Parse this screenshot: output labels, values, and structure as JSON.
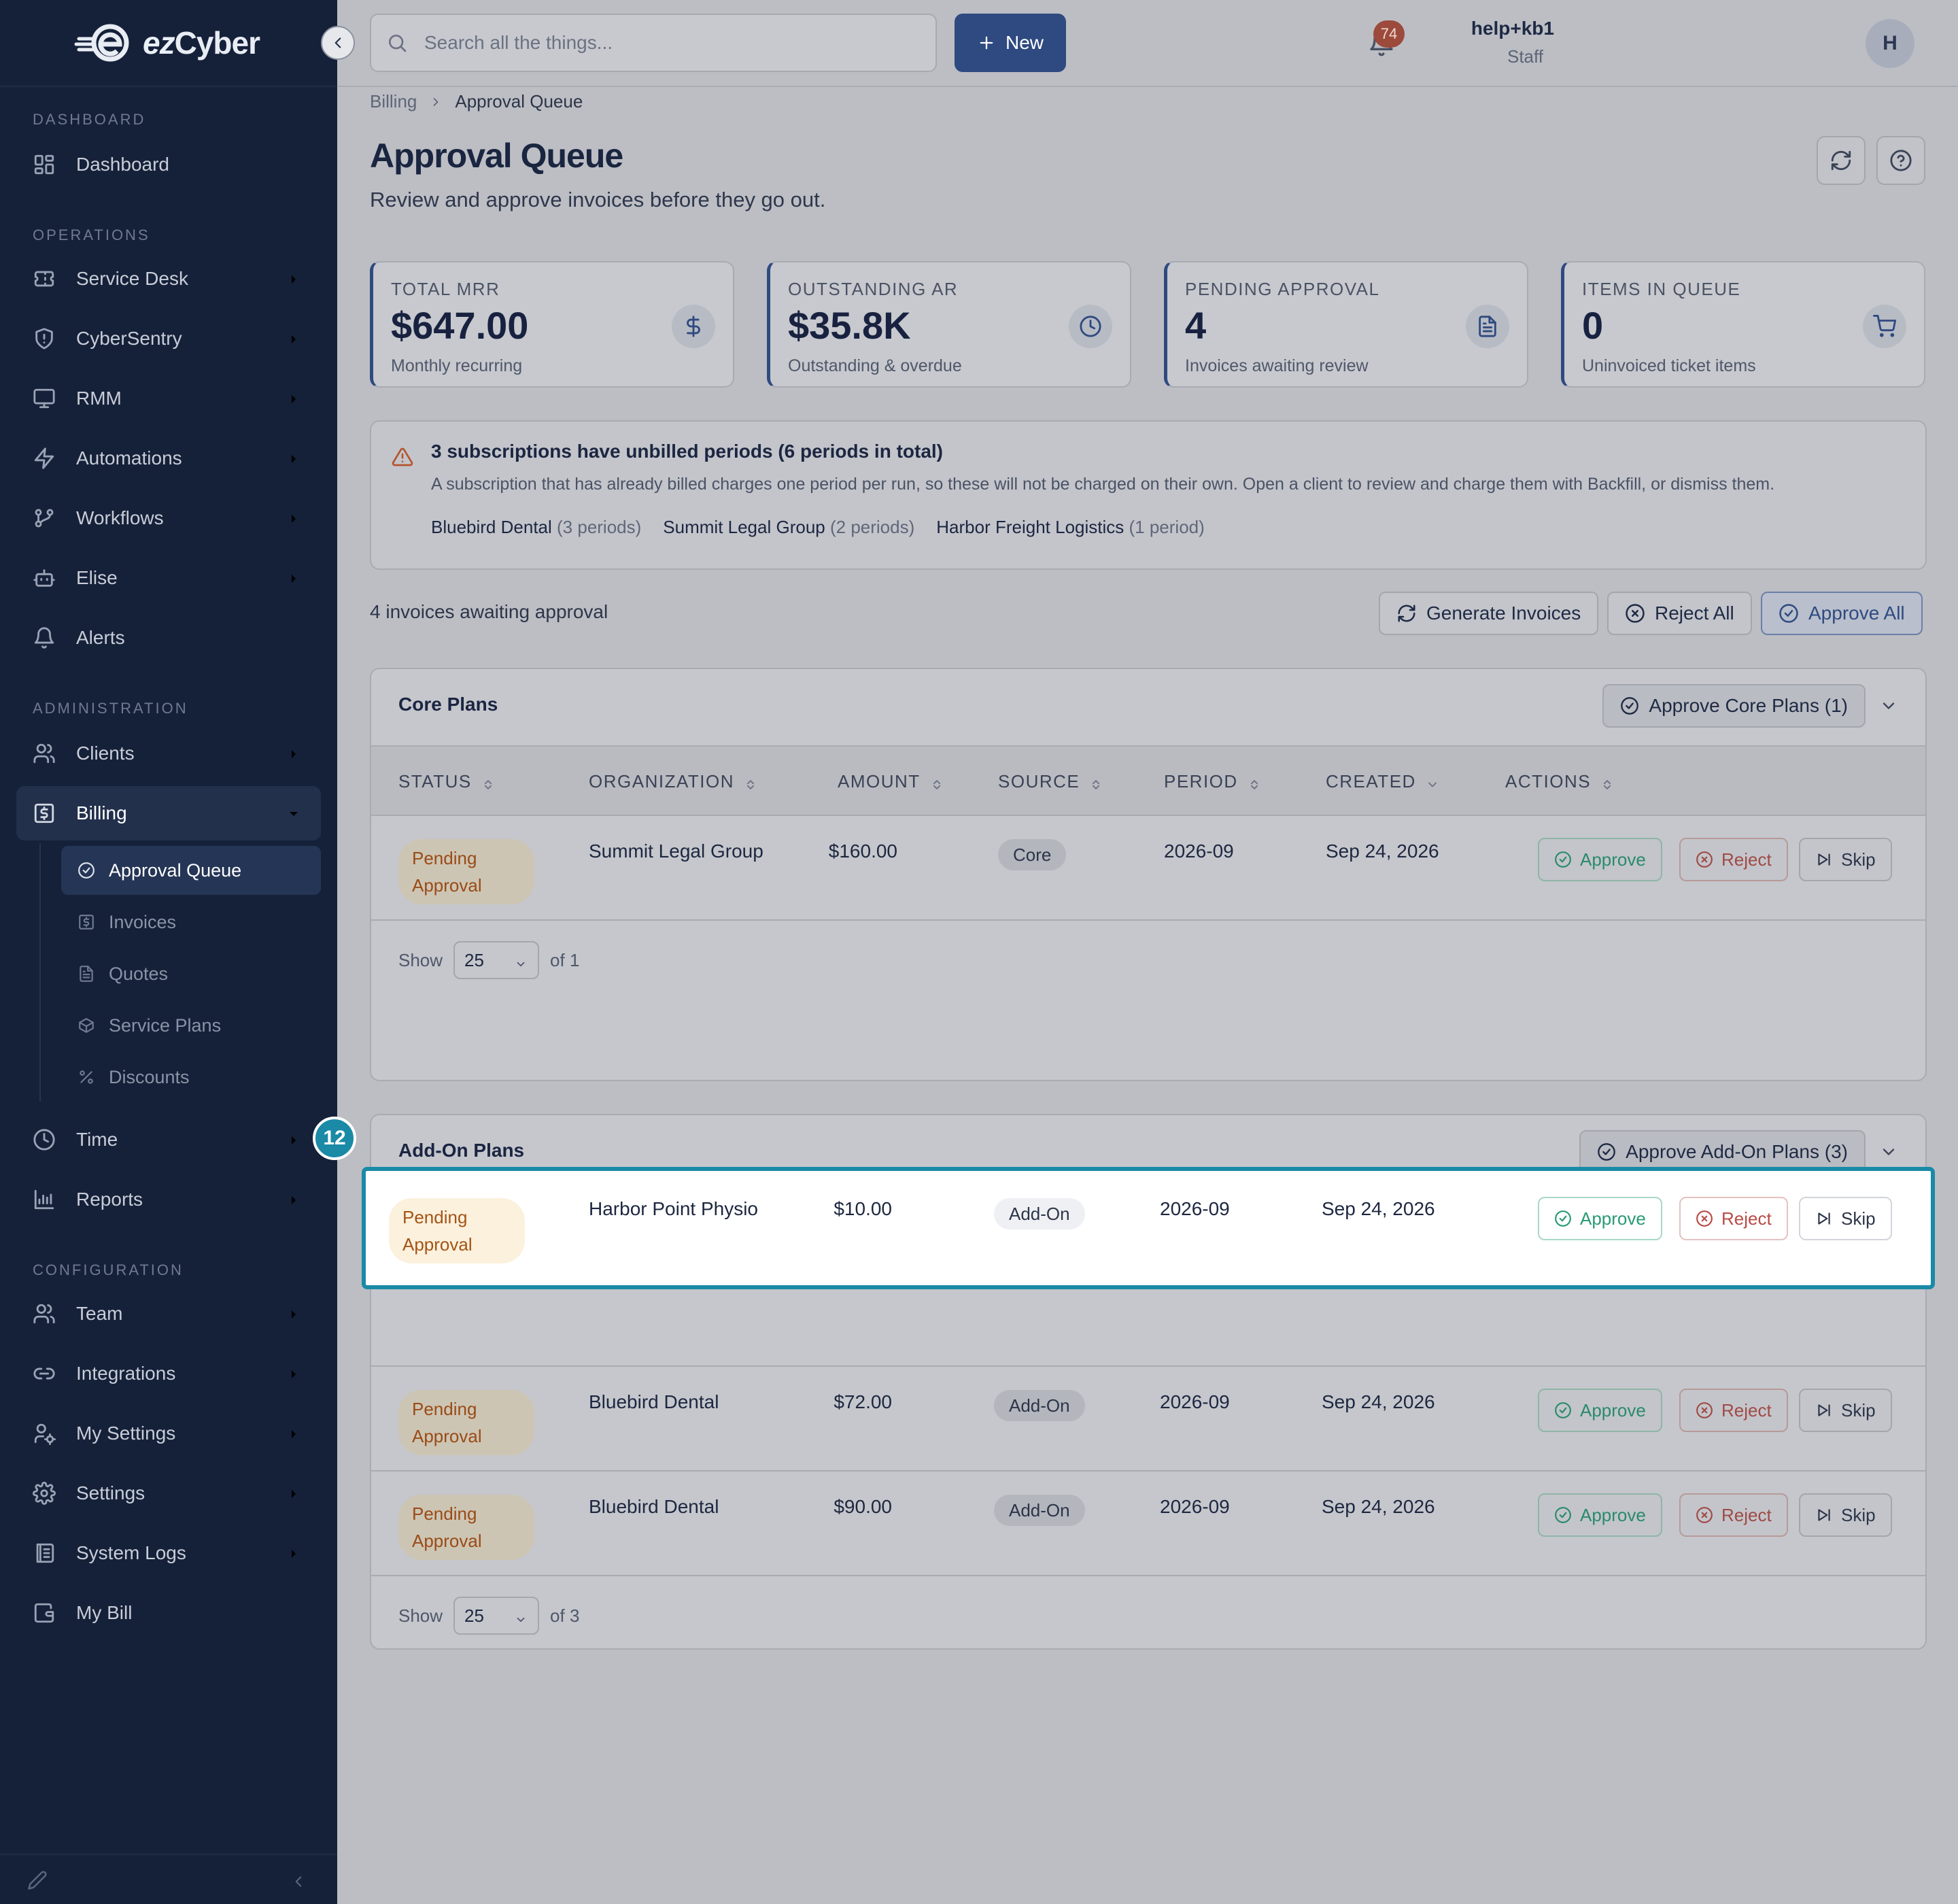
{
  "brand": {
    "name_prefix": "ez",
    "name_suffix": "Cyber"
  },
  "sidebar": {
    "sections": {
      "dashboard": "DASHBOARD",
      "operations": "OPERATIONS",
      "administration": "ADMINISTRATION",
      "configuration": "CONFIGURATION"
    },
    "items": {
      "dashboard": "Dashboard",
      "service_desk": "Service Desk",
      "cybersentry": "CyberSentry",
      "rmm": "RMM",
      "automations": "Automations",
      "workflows": "Workflows",
      "elise": "Elise",
      "alerts": "Alerts",
      "clients": "Clients",
      "billing": "Billing",
      "time": "Time",
      "reports": "Reports",
      "team": "Team",
      "integrations": "Integrations",
      "my_settings": "My Settings",
      "settings": "Settings",
      "system_logs": "System Logs",
      "my_bill": "My Bill"
    },
    "billing_sub": {
      "approval_queue": "Approval Queue",
      "invoices": "Invoices",
      "quotes": "Quotes",
      "service_plans": "Service Plans",
      "discounts": "Discounts"
    }
  },
  "header": {
    "search_placeholder": "Search all the things...",
    "new_label": "New",
    "notification_count": "74",
    "user_name": "help+kb1",
    "user_role": "Staff",
    "avatar_initial": "H"
  },
  "breadcrumb": {
    "parent": "Billing",
    "current": "Approval Queue"
  },
  "page": {
    "title": "Approval Queue",
    "subtitle": "Review and approve invoices before they go out."
  },
  "stats": [
    {
      "label": "TOTAL MRR",
      "value": "$647.00",
      "desc": "Monthly recurring",
      "icon": "dollar-icon"
    },
    {
      "label": "OUTSTANDING AR",
      "value": "$35.8K",
      "desc": "Outstanding & overdue",
      "icon": "clock-icon"
    },
    {
      "label": "PENDING APPROVAL",
      "value": "4",
      "desc": "Invoices awaiting review",
      "icon": "document-icon"
    },
    {
      "label": "ITEMS IN QUEUE",
      "value": "0",
      "desc": "Uninvoiced ticket items",
      "icon": "cart-icon"
    }
  ],
  "alert": {
    "title": "3 subscriptions have unbilled periods (6 periods in total)",
    "body": "A subscription that has already billed charges one period per run, so these will not be charged on their own. Open a client to review and charge them with Backfill, or dismiss them.",
    "chips": [
      {
        "name": "Bluebird Dental",
        "periods": "(3 periods)"
      },
      {
        "name": "Summit Legal Group",
        "periods": "(2 periods)"
      },
      {
        "name": "Harbor Freight Logistics",
        "periods": "(1 period)"
      }
    ]
  },
  "toolbar": {
    "count_text": "4 invoices awaiting approval",
    "generate": "Generate Invoices",
    "reject_all": "Reject All",
    "approve_all": "Approve All"
  },
  "columns": {
    "status": "STATUS",
    "organization": "ORGANIZATION",
    "amount": "AMOUNT",
    "source": "SOURCE",
    "period": "PERIOD",
    "created": "CREATED",
    "actions": "ACTIONS"
  },
  "actions": {
    "approve": "Approve",
    "reject": "Reject",
    "skip": "Skip"
  },
  "core": {
    "title": "Core Plans",
    "approve_label": "Approve Core Plans (1)",
    "rows": [
      {
        "status": "Pending Approval",
        "org": "Summit Legal Group",
        "amount": "$160.00",
        "source": "Core",
        "period": "2026-09",
        "created": "Sep 24, 2026"
      }
    ],
    "footer": {
      "show": "Show",
      "page_size": "25",
      "of": "of 1"
    }
  },
  "addon": {
    "title": "Add-On Plans",
    "approve_label": "Approve Add-On Plans (3)",
    "rows": [
      {
        "status": "Pending Approval",
        "org": "Harbor Point Physio",
        "amount": "$10.00",
        "source": "Add-On",
        "period": "2026-09",
        "created": "Sep 24, 2026"
      },
      {
        "status": "Pending Approval",
        "org": "Bluebird Dental",
        "amount": "$72.00",
        "source": "Add-On",
        "period": "2026-09",
        "created": "Sep 24, 2026"
      },
      {
        "status": "Pending Approval",
        "org": "Bluebird Dental",
        "amount": "$90.00",
        "source": "Add-On",
        "period": "2026-09",
        "created": "Sep 24, 2026"
      }
    ],
    "footer": {
      "show": "Show",
      "page_size": "25",
      "of": "of 3"
    }
  },
  "highlight_marker": "12",
  "colors": {
    "accent": "#2f4a80",
    "highlight": "#1a8aa6",
    "approve": "#2a9a74",
    "reject": "#b84c46",
    "pending": "#a45417"
  }
}
